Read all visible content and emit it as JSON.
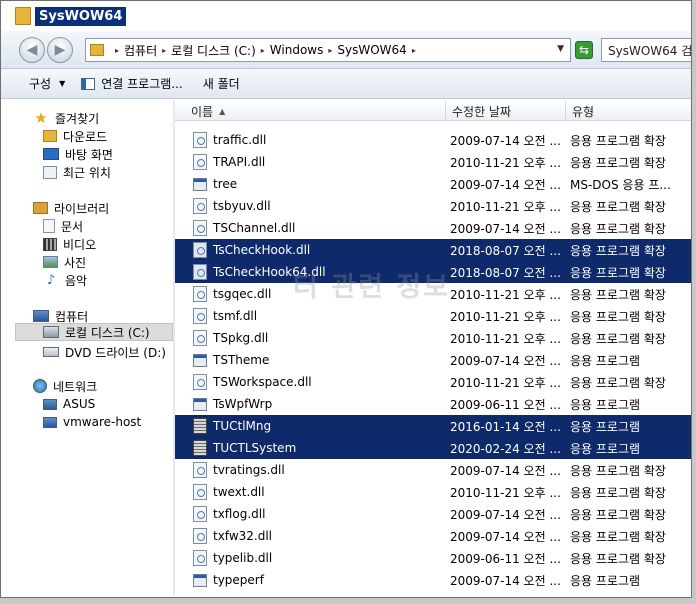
{
  "window": {
    "title": "SysWOW64"
  },
  "address": {
    "crumbs": [
      "컴퓨터",
      "로컬 디스크 (C:)",
      "Windows",
      "SysWOW64"
    ],
    "search_text": "SysWOW64 검"
  },
  "toolbar": {
    "organize": "구성",
    "open_with": "연결 프로그램...",
    "new_folder": "새 폴더"
  },
  "nav": {
    "favorites": "즐겨찾기",
    "downloads": "다운로드",
    "desktop": "바탕 화면",
    "recent": "최근 위치",
    "libraries": "라이브러리",
    "documents": "문서",
    "videos": "비디오",
    "pictures": "사진",
    "music": "음악",
    "computer": "컴퓨터",
    "local_disk": "로컬 디스크 (C:)",
    "dvd": "DVD 드라이브 (D:)",
    "network": "네트워크",
    "asus": "ASUS",
    "vmware": "vmware-host"
  },
  "columns": {
    "name": "이름",
    "date": "수정한 날짜",
    "type": "유형"
  },
  "files": [
    {
      "name": "traffic.dll",
      "date": "2009-07-14 오전 ...",
      "type": "응용 프로그램 확장",
      "icon": "dll",
      "selected": false
    },
    {
      "name": "TRAPI.dll",
      "date": "2010-11-21 오후 ...",
      "type": "응용 프로그램 확장",
      "icon": "dll",
      "selected": false
    },
    {
      "name": "tree",
      "date": "2009-07-14 오전 ...",
      "type": "MS-DOS 응용 프...",
      "icon": "exe",
      "selected": false
    },
    {
      "name": "tsbyuv.dll",
      "date": "2010-11-21 오후 ...",
      "type": "응용 프로그램 확장",
      "icon": "dll",
      "selected": false
    },
    {
      "name": "TSChannel.dll",
      "date": "2009-07-14 오전 ...",
      "type": "응용 프로그램 확장",
      "icon": "dll",
      "selected": false
    },
    {
      "name": "TsCheckHook.dll",
      "date": "2018-08-07 오전 ...",
      "type": "응용 프로그램 확장",
      "icon": "dll",
      "selected": true
    },
    {
      "name": "TsCheckHook64.dll",
      "date": "2018-08-07 오전 ...",
      "type": "응용 프로그램 확장",
      "icon": "dll",
      "selected": true
    },
    {
      "name": "tsgqec.dll",
      "date": "2010-11-21 오후 ...",
      "type": "응용 프로그램 확장",
      "icon": "dll",
      "selected": false
    },
    {
      "name": "tsmf.dll",
      "date": "2010-11-21 오후 ...",
      "type": "응용 프로그램 확장",
      "icon": "dll",
      "selected": false
    },
    {
      "name": "TSpkg.dll",
      "date": "2010-11-21 오후 ...",
      "type": "응용 프로그램 확장",
      "icon": "dll",
      "selected": false
    },
    {
      "name": "TSTheme",
      "date": "2009-07-14 오전 ...",
      "type": "응용 프로그램",
      "icon": "exe",
      "selected": false
    },
    {
      "name": "TSWorkspace.dll",
      "date": "2010-11-21 오후 ...",
      "type": "응용 프로그램 확장",
      "icon": "dll",
      "selected": false
    },
    {
      "name": "TsWpfWrp",
      "date": "2009-06-11 오전 ...",
      "type": "응용 프로그램",
      "icon": "exe",
      "selected": false
    },
    {
      "name": "TUCtlMng",
      "date": "2016-01-14 오전 ...",
      "type": "응용 프로그램",
      "icon": "app",
      "selected": true
    },
    {
      "name": "TUCTLSystem",
      "date": "2020-02-24 오전 ...",
      "type": "응용 프로그램",
      "icon": "app",
      "selected": true
    },
    {
      "name": "tvratings.dll",
      "date": "2009-07-14 오전 ...",
      "type": "응용 프로그램 확장",
      "icon": "dll",
      "selected": false
    },
    {
      "name": "twext.dll",
      "date": "2010-11-21 오후 ...",
      "type": "응용 프로그램 확장",
      "icon": "dll",
      "selected": false
    },
    {
      "name": "txflog.dll",
      "date": "2009-07-14 오전 ...",
      "type": "응용 프로그램 확장",
      "icon": "dll",
      "selected": false
    },
    {
      "name": "txfw32.dll",
      "date": "2009-07-14 오전 ...",
      "type": "응용 프로그램 확장",
      "icon": "dll",
      "selected": false
    },
    {
      "name": "typelib.dll",
      "date": "2009-06-11 오전 ...",
      "type": "응용 프로그램 확장",
      "icon": "dll",
      "selected": false
    },
    {
      "name": "typeperf",
      "date": "2009-07-14 오전 ...",
      "type": "응용 프로그램",
      "icon": "exe",
      "selected": false
    }
  ],
  "watermark": "터 관련 정보",
  "colors": {
    "selection": "#0e2a6b",
    "title_highlight": "#0c2f7a"
  }
}
